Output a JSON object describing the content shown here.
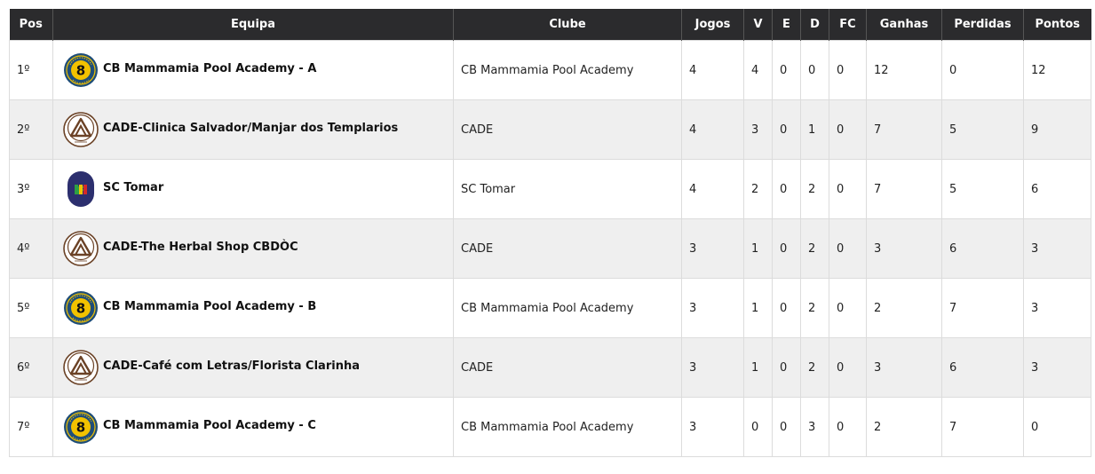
{
  "table": {
    "headers": {
      "pos": "Pos",
      "equipa": "Equipa",
      "clube": "Clube",
      "jogos": "Jogos",
      "v": "V",
      "e": "E",
      "d": "D",
      "fc": "FC",
      "ganhas": "Ganhas",
      "perdidas": "Perdidas",
      "pontos": "Pontos"
    },
    "rows": [
      {
        "pos": "1º",
        "logo": "mammamia-8-ball-logo",
        "equipa": "CB Mammamia Pool Academy - A",
        "clube": "CB Mammamia Pool Academy",
        "jogos": "4",
        "v": "4",
        "e": "0",
        "d": "0",
        "fc": "0",
        "ganhas": "12",
        "perdidas": "0",
        "pontos": "12"
      },
      {
        "pos": "2º",
        "logo": "cade-logo",
        "equipa": "CADE-Clinica Salvador/Manjar dos Templarios",
        "clube": "CADE",
        "jogos": "4",
        "v": "3",
        "e": "0",
        "d": "1",
        "fc": "0",
        "ganhas": "7",
        "perdidas": "5",
        "pontos": "9"
      },
      {
        "pos": "3º",
        "logo": "fpb-logo",
        "equipa": "SC Tomar",
        "clube": "SC Tomar",
        "jogos": "4",
        "v": "2",
        "e": "0",
        "d": "2",
        "fc": "0",
        "ganhas": "7",
        "perdidas": "5",
        "pontos": "6"
      },
      {
        "pos": "4º",
        "logo": "cade-logo",
        "equipa": "CADE-The Herbal Shop CBDÒC",
        "clube": "CADE",
        "jogos": "3",
        "v": "1",
        "e": "0",
        "d": "2",
        "fc": "0",
        "ganhas": "3",
        "perdidas": "6",
        "pontos": "3"
      },
      {
        "pos": "5º",
        "logo": "mammamia-8-ball-logo",
        "equipa": "CB Mammamia Pool Academy - B",
        "clube": "CB Mammamia Pool Academy",
        "jogos": "3",
        "v": "1",
        "e": "0",
        "d": "2",
        "fc": "0",
        "ganhas": "2",
        "perdidas": "7",
        "pontos": "3"
      },
      {
        "pos": "6º",
        "logo": "cade-logo",
        "equipa": "CADE-Café com Letras/Florista Clarinha",
        "clube": "CADE",
        "jogos": "3",
        "v": "1",
        "e": "0",
        "d": "2",
        "fc": "0",
        "ganhas": "3",
        "perdidas": "6",
        "pontos": "3"
      },
      {
        "pos": "7º",
        "logo": "mammamia-8-ball-logo",
        "equipa": "CB Mammamia Pool Academy - C",
        "clube": "CB Mammamia Pool Academy",
        "jogos": "3",
        "v": "0",
        "e": "0",
        "d": "3",
        "fc": "0",
        "ganhas": "2",
        "perdidas": "7",
        "pontos": "0"
      }
    ]
  },
  "colors": {
    "header_bg": "#2b2b2d",
    "header_text": "#ffffff",
    "row_alt_bg": "#efefef",
    "border": "#dcdcdc",
    "mammamia_blue": "#1f4e79",
    "mammamia_yellow": "#f2c200",
    "cade_brown": "#6b4226",
    "fpb_navy": "#2c2f6e"
  }
}
